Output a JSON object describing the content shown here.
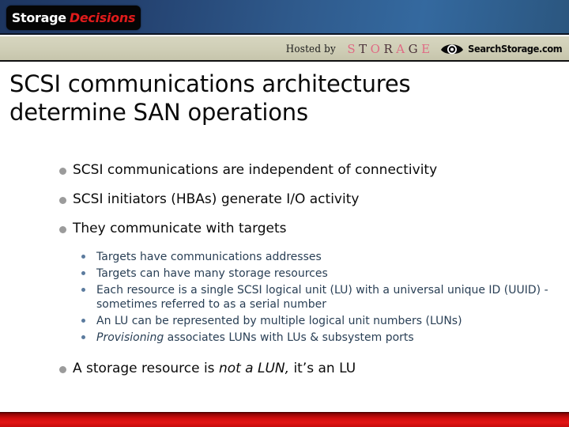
{
  "header": {
    "brand": {
      "storage": "Storage",
      "decisions": "Decisions"
    },
    "hosted_by_label": "Hosted by",
    "storage_wordmark": [
      "S",
      "T",
      "O",
      "R",
      "A",
      "G",
      "E"
    ],
    "searchstorage_name": "SearchStorage.com",
    "colors": {
      "header_blue": "#2f5a8c",
      "header_beige": "#cfceb6",
      "brand_box": "#050505",
      "brand_decisions_red": "#e01b1b",
      "wordmark_pink": "#e06a84",
      "wordmark_dark": "#4a3038",
      "footer_red": "#d10d0d",
      "bullet_gray": "#9b9b9b",
      "subbullet_blue": "#5b7b9e"
    }
  },
  "slide": {
    "title": "SCSI communications architectures determine SAN operations",
    "bullets": [
      {
        "text": "SCSI communications are independent of connectivity",
        "sub": []
      },
      {
        "text": "SCSI initiators (HBAs) generate I/O activity",
        "sub": []
      },
      {
        "text": "They communicate with targets",
        "sub": [
          "Targets have communications addresses",
          "Targets can have many storage resources",
          "Each resource is a single SCSI logical unit (LU) with a universal unique ID (UUID)  - sometimes referred to as a serial number",
          "An LU can be represented by multiple logical unit numbers (LUNs)"
        ],
        "sub_italic_last": {
          "italic": "Provisioning",
          "rest": " associates LUNs with LUs & subsystem ports"
        }
      }
    ],
    "final_bullet": {
      "before": "A storage resource is ",
      "italic": "not a LUN,",
      "after": " it’s an LU"
    }
  }
}
